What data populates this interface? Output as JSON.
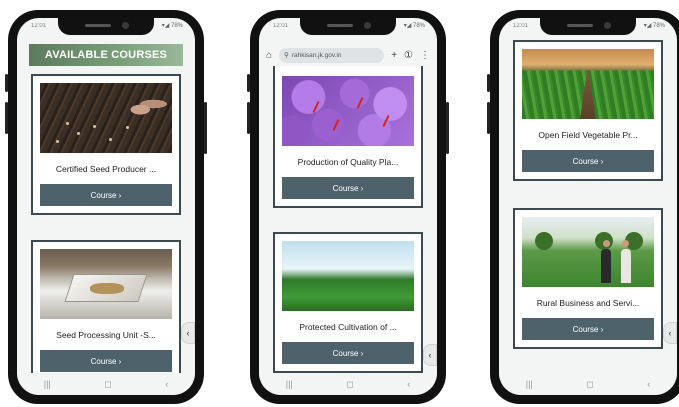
{
  "status": {
    "time": "12:01",
    "icons": "▾◢ 78%"
  },
  "phone1": {
    "header": "AVAILABLE COURSES",
    "cards": [
      {
        "title": "Certified Seed Producer ...",
        "button": "Course ›"
      },
      {
        "title": "Seed Processing Unit -S...",
        "button": "Course ›"
      }
    ]
  },
  "phone2": {
    "browser": {
      "url": "rahkisan.jk.gov.in",
      "plus": "+",
      "tabs": "①",
      "menu": "⋮",
      "home": "⌂"
    },
    "cards": [
      {
        "title": "Production of Quality Pla...",
        "button": "Course ›"
      },
      {
        "title": "Protected Cultivation of ...",
        "button": "Course ›"
      }
    ]
  },
  "phone3": {
    "cards": [
      {
        "title": "Open Field Vegetable Pr...",
        "button": "Course ›"
      },
      {
        "title": "Rural Business and Servi...",
        "button": "Course ›"
      }
    ]
  },
  "nav": {
    "recents": "|||",
    "home": "◻",
    "back": "‹"
  },
  "side_tab": "‹"
}
